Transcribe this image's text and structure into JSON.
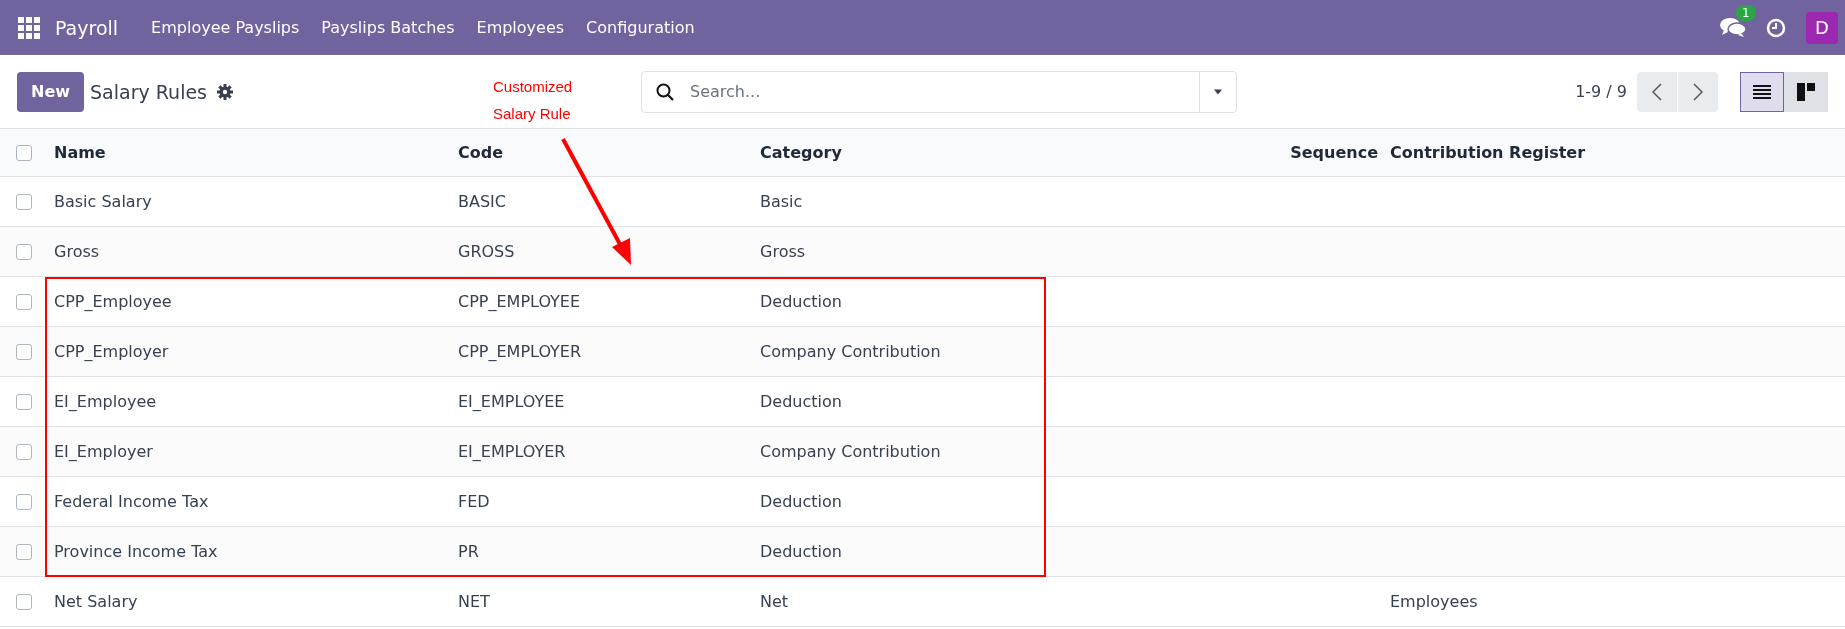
{
  "navbar": {
    "app_name": "Payroll",
    "menu": [
      "Employee Payslips",
      "Payslips Batches",
      "Employees",
      "Configuration"
    ],
    "messages_badge": "1",
    "avatar": "D"
  },
  "control_panel": {
    "new_button": "New",
    "title": "Salary Rules",
    "search": {
      "placeholder": "Search..."
    },
    "pager": "1-9 / 9",
    "view_switcher": [
      {
        "kind": "list",
        "selected": true
      },
      {
        "kind": "kanban",
        "selected": false
      }
    ]
  },
  "annotation": {
    "label": "Customized Salary Rule"
  },
  "table": {
    "select_all": {
      "selected": false
    },
    "columns": [
      {
        "label": "Name",
        "kind": "text"
      },
      {
        "label": "Code",
        "kind": "text"
      },
      {
        "label": "Category",
        "kind": "text"
      },
      {
        "label": "Sequence",
        "kind": "number"
      },
      {
        "label": "Contribution Register",
        "kind": "text"
      }
    ],
    "rows": [
      {
        "cells": [
          "Basic Salary",
          "BASIC",
          "Basic",
          "",
          ""
        ],
        "selected": false,
        "highlighted": false
      },
      {
        "cells": [
          "Gross",
          "GROSS",
          "Gross",
          "",
          ""
        ],
        "selected": false,
        "highlighted": false
      },
      {
        "cells": [
          "CPP_Employee",
          "CPP_EMPLOYEE",
          "Deduction",
          "",
          ""
        ],
        "selected": false,
        "highlighted": true
      },
      {
        "cells": [
          "CPP_Employer",
          "CPP_EMPLOYER",
          "Company Contribution",
          "",
          ""
        ],
        "selected": false,
        "highlighted": true
      },
      {
        "cells": [
          "EI_Employee",
          "EI_EMPLOYEE",
          "Deduction",
          "",
          ""
        ],
        "selected": false,
        "highlighted": true
      },
      {
        "cells": [
          "EI_Employer",
          "EI_EMPLOYER",
          "Company Contribution",
          "",
          ""
        ],
        "selected": false,
        "highlighted": true
      },
      {
        "cells": [
          "Federal Income Tax",
          "FED",
          "Deduction",
          "",
          ""
        ],
        "selected": false,
        "highlighted": true
      },
      {
        "cells": [
          "Province Income Tax",
          "PR",
          "Deduction",
          "",
          ""
        ],
        "selected": false,
        "highlighted": true
      },
      {
        "cells": [
          "Net Salary",
          "NET",
          "Net",
          "",
          "Employees"
        ],
        "selected": false,
        "highlighted": false
      }
    ]
  }
}
